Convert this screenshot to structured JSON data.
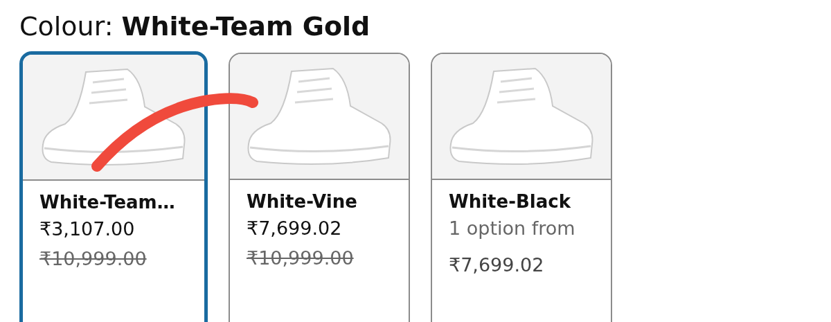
{
  "heading": {
    "label": "Colour:",
    "value": "White-Team Gold"
  },
  "swatches": [
    {
      "kind": "offer",
      "name": "White-Team…",
      "selected": true,
      "price": "₹3,107.00",
      "list_price": "₹10,999.00"
    },
    {
      "kind": "offer",
      "name": "White-Vine",
      "selected": false,
      "price": "₹7,699.02",
      "list_price": "₹10,999.00"
    },
    {
      "kind": "options",
      "name": "White-Black",
      "selected": false,
      "options": "1 option from",
      "price": "₹7,699.02"
    }
  ]
}
